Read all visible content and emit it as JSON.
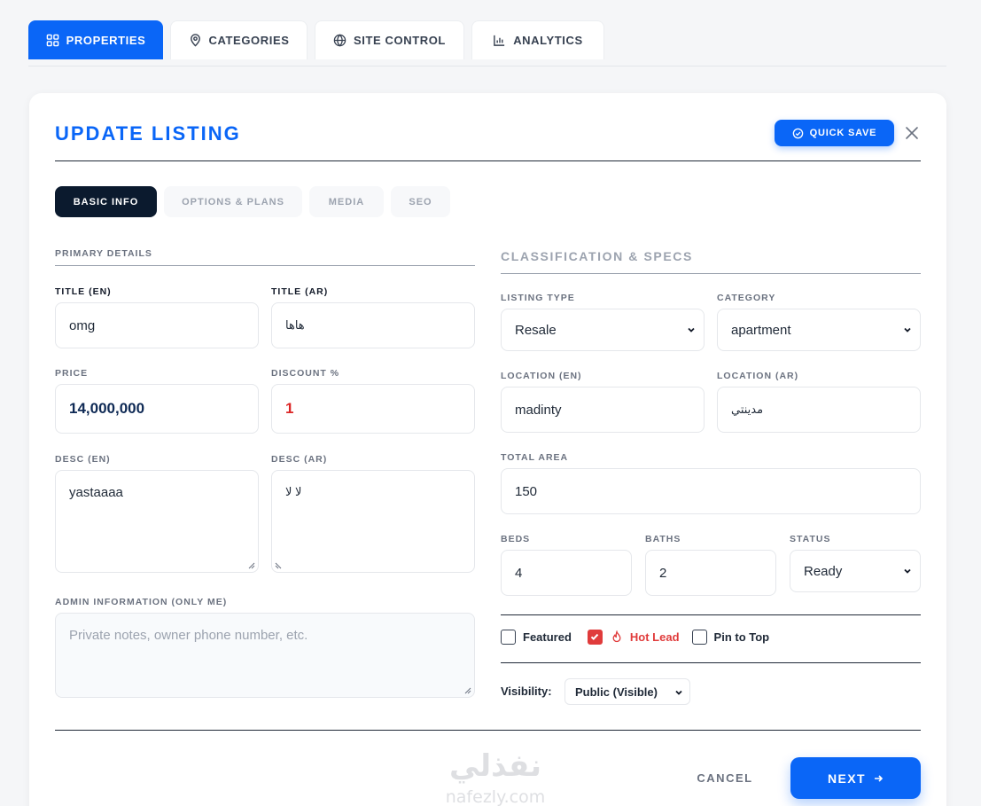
{
  "nav": {
    "tabs": [
      {
        "label": "PROPERTIES",
        "icon": "grid-icon"
      },
      {
        "label": "CATEGORIES",
        "icon": "map-pin-icon"
      },
      {
        "label": "SITE CONTROL",
        "icon": "globe-icon"
      },
      {
        "label": "ANALYTICS",
        "icon": "bar-chart-icon"
      }
    ],
    "active": "PROPERTIES"
  },
  "header": {
    "title": "UPDATE LISTING",
    "quick_save": "QUICK SAVE"
  },
  "subtabs": [
    {
      "label": "BASIC INFO"
    },
    {
      "label": "OPTIONS & PLANS"
    },
    {
      "label": "MEDIA"
    },
    {
      "label": "SEO"
    }
  ],
  "primary": {
    "section": "PRIMARY DETAILS",
    "title_en": {
      "label": "TITLE (EN)",
      "value": "omg"
    },
    "title_ar": {
      "label": "TITLE (AR)",
      "value": "هاها"
    },
    "price": {
      "label": "PRICE",
      "value": "14,000,000"
    },
    "discount": {
      "label": "DISCOUNT %",
      "value": "1"
    },
    "desc_en": {
      "label": "DESC (EN)",
      "value": "yastaaaa"
    },
    "desc_ar": {
      "label": "DESC (AR)",
      "value": "لا لا"
    },
    "admin": {
      "label": "ADMIN INFORMATION (ONLY ME)",
      "placeholder": "Private notes, owner phone number, etc."
    }
  },
  "classification": {
    "section": "CLASSIFICATION & SPECS",
    "listing_type": {
      "label": "LISTING TYPE",
      "value": "Resale"
    },
    "category": {
      "label": "CATEGORY",
      "value": "apartment"
    },
    "location_en": {
      "label": "LOCATION (EN)",
      "value": "madinty"
    },
    "location_ar": {
      "label": "LOCATION (AR)",
      "value": "مدينتي"
    },
    "total_area": {
      "label": "TOTAL AREA",
      "value": "150"
    },
    "beds": {
      "label": "BEDS",
      "value": "4"
    },
    "baths": {
      "label": "BATHS",
      "value": "2"
    },
    "status": {
      "label": "STATUS",
      "value": "Ready"
    },
    "flags": {
      "featured": {
        "label": "Featured",
        "checked": false
      },
      "hot_lead": {
        "label": "Hot Lead",
        "checked": true
      },
      "pin_to_top": {
        "label": "Pin to Top",
        "checked": false
      }
    },
    "visibility": {
      "label": "Visibility:",
      "value": "Public (Visible)"
    }
  },
  "footer": {
    "cancel": "CANCEL",
    "next": "NEXT"
  },
  "colors": {
    "accent": "#0a66f7",
    "dark_tab": "#0b1a2e",
    "danger": "#e03b3b"
  }
}
